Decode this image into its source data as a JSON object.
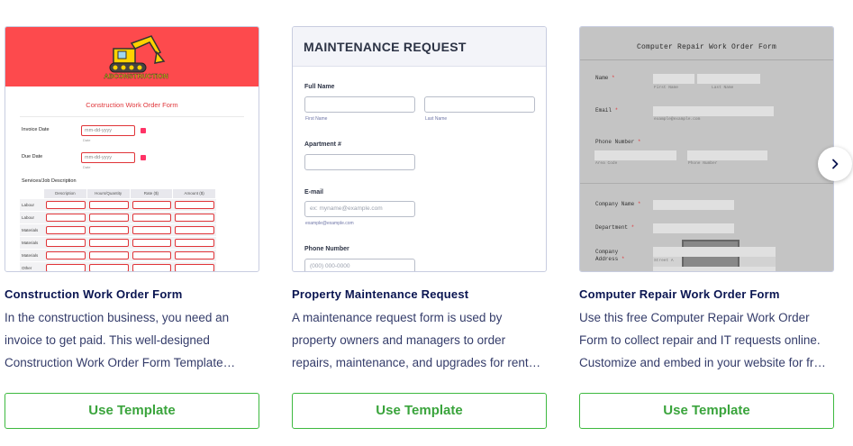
{
  "cards": [
    {
      "title": "Construction Work Order Form",
      "desc": [
        "In the construction business, you need an",
        "invoice to get paid. This well-designed",
        "Construction Work Order Form Template…"
      ],
      "button": "Use Template",
      "thumb": {
        "logo_text": "ABCONSTRUCTION",
        "form_title": "Construction Work Order Form",
        "invoice_label": "Invoice Date",
        "due_label": "Due Date",
        "date_placeholder": "mm-dd-yyyy",
        "date_sub": "Date",
        "section_label": "Services/Job Description",
        "columns": [
          "Description",
          "Hours/Quantity",
          "Rate ($)",
          "Amount ($)"
        ],
        "rows": [
          "Labour",
          "Labour",
          "Materials",
          "Materials",
          "Materials",
          "Other"
        ],
        "accent": "#fd4a4d"
      }
    },
    {
      "title": "Property Maintenance Request",
      "desc": [
        "A maintenance request form is used by",
        "property owners and managers to order",
        "repairs, maintenance, and upgrades for rent…"
      ],
      "button": "Use Template",
      "thumb": {
        "header": "MAINTENANCE REQUEST",
        "full_name": "Full Name",
        "first_name": "First Name",
        "last_name": "Last Name",
        "apartment": "Apartment #",
        "email": "E-mail",
        "email_placeholder": "ex: myname@example.com",
        "email_sub": "example@example.com",
        "phone": "Phone Number",
        "phone_placeholder": "(000) 000-0000"
      }
    },
    {
      "title": "Computer Repair Work Order Form",
      "desc": [
        "Use this free Computer Repair Work Order",
        "Form to collect repair and IT requests online.",
        "Customize and embed in your website for fr…"
      ],
      "button": "Use Template",
      "thumb": {
        "form_title": "Computer Repair Work Order Form",
        "name": "Name",
        "first_name": "First Name",
        "last_name": "Last Name",
        "email": "Email",
        "email_sub": "example@example.com",
        "phone": "Phone Number",
        "area_code": "Area Code",
        "phone_sub": "Phone Number",
        "company": "Company Name",
        "department": "Department",
        "company_address": [
          "Company",
          "Address"
        ],
        "street": "Street A",
        "required_mark": "*"
      }
    }
  ],
  "carousel": {
    "next_icon": "chevron-right-icon"
  },
  "colors": {
    "brand_green": "#3db93f",
    "title_navy": "#0a1551",
    "required_red": "#e03438"
  }
}
